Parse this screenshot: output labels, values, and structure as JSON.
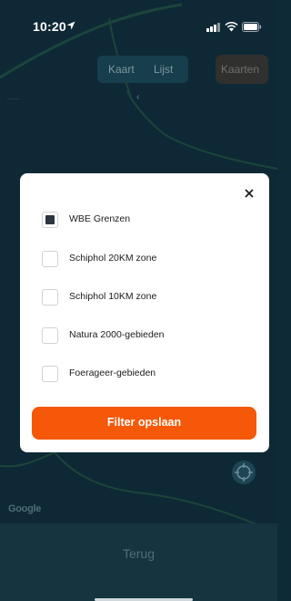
{
  "status_bar": {
    "time": "10:20",
    "icons": [
      "location-arrow-icon",
      "signal-icon",
      "wifi-icon",
      "battery-icon"
    ]
  },
  "map_view": {
    "segments": [
      "Kaart",
      "Lijst"
    ],
    "maps_button": "Kaarten",
    "attribution": "Google",
    "locate_icon": "crosshair-icon"
  },
  "filter_modal": {
    "close_icon": "close-icon",
    "options": [
      {
        "label": "WBE Grenzen",
        "checked": true
      },
      {
        "label": "Schiphol 20KM zone",
        "checked": false
      },
      {
        "label": "Schiphol 10KM zone",
        "checked": false
      },
      {
        "label": "Natura 2000-gebieden",
        "checked": false
      },
      {
        "label": "Foerageer-gebieden",
        "checked": false
      }
    ],
    "save_button": "Filter opslaan"
  },
  "bottom_bar": {
    "back_label": "Terug"
  },
  "colors": {
    "accent": "#f55808",
    "map_background": "#143a48",
    "map_roads": "#2f6a52",
    "modal_background": "#ffffff"
  }
}
